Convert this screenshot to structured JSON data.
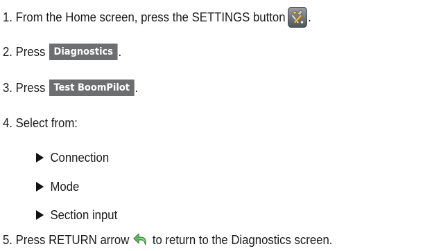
{
  "steps": [
    {
      "num": "1.",
      "before": "From the Home screen, press the SETTINGS button",
      "icon": "settings-tools-icon",
      "after": "."
    },
    {
      "num": "2.",
      "before": "Press",
      "button": "Diagnostics",
      "after": "."
    },
    {
      "num": "3.",
      "before": "Press",
      "button": "Test BoomPilot",
      "after": "."
    },
    {
      "num": "4.",
      "text": "Select from:"
    },
    {
      "num": "5.",
      "before": "Press RETURN arrow",
      "icon": "return-arrow-icon",
      "after": "to return to the Diagnostics screen."
    }
  ],
  "options": [
    "Connection",
    "Mode",
    "Section input"
  ],
  "colors": {
    "ui_button_bg": "#6d6e70",
    "ui_button_text": "#ffffff",
    "text": "#1a1a1a"
  }
}
